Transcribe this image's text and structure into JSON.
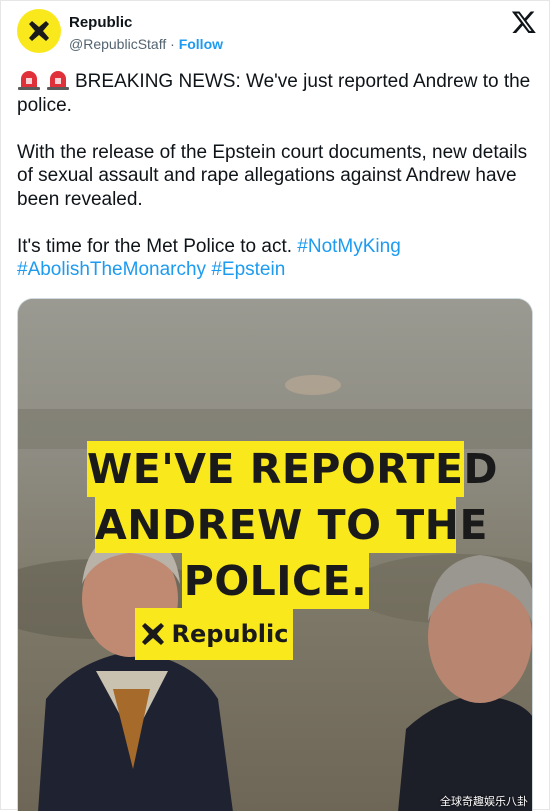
{
  "account": {
    "name": "Republic",
    "handle": "@RepublicStaff",
    "separator": "·",
    "follow_label": "Follow",
    "avatar_color": "#f9e81c"
  },
  "icons": {
    "platform": "x-logo-icon",
    "siren": "police-light-icon",
    "avatar": "republic-logo-icon"
  },
  "tweet": {
    "p1": "BREAKING NEWS: We've just reported Andrew to the police.",
    "p2": "With the release of the Epstein court documents, new details of sexual assault and rape allegations against Andrew have been revealed.",
    "p3": "It's time for the Met Police to act.",
    "hashtags": [
      "#NotMyKing",
      "#AbolishTheMonarchy",
      "#Epstein"
    ]
  },
  "media": {
    "headline_lines": [
      "WE'VE REPORTED",
      "ANDREW TO THE",
      "POLICE."
    ],
    "brand": "Republic",
    "accent_color": "#f9e81c"
  },
  "watermark": "全球奇趣娱乐八卦",
  "colors": {
    "link": "#1d9bf0",
    "text": "#0f1419",
    "secondary": "#536471"
  }
}
